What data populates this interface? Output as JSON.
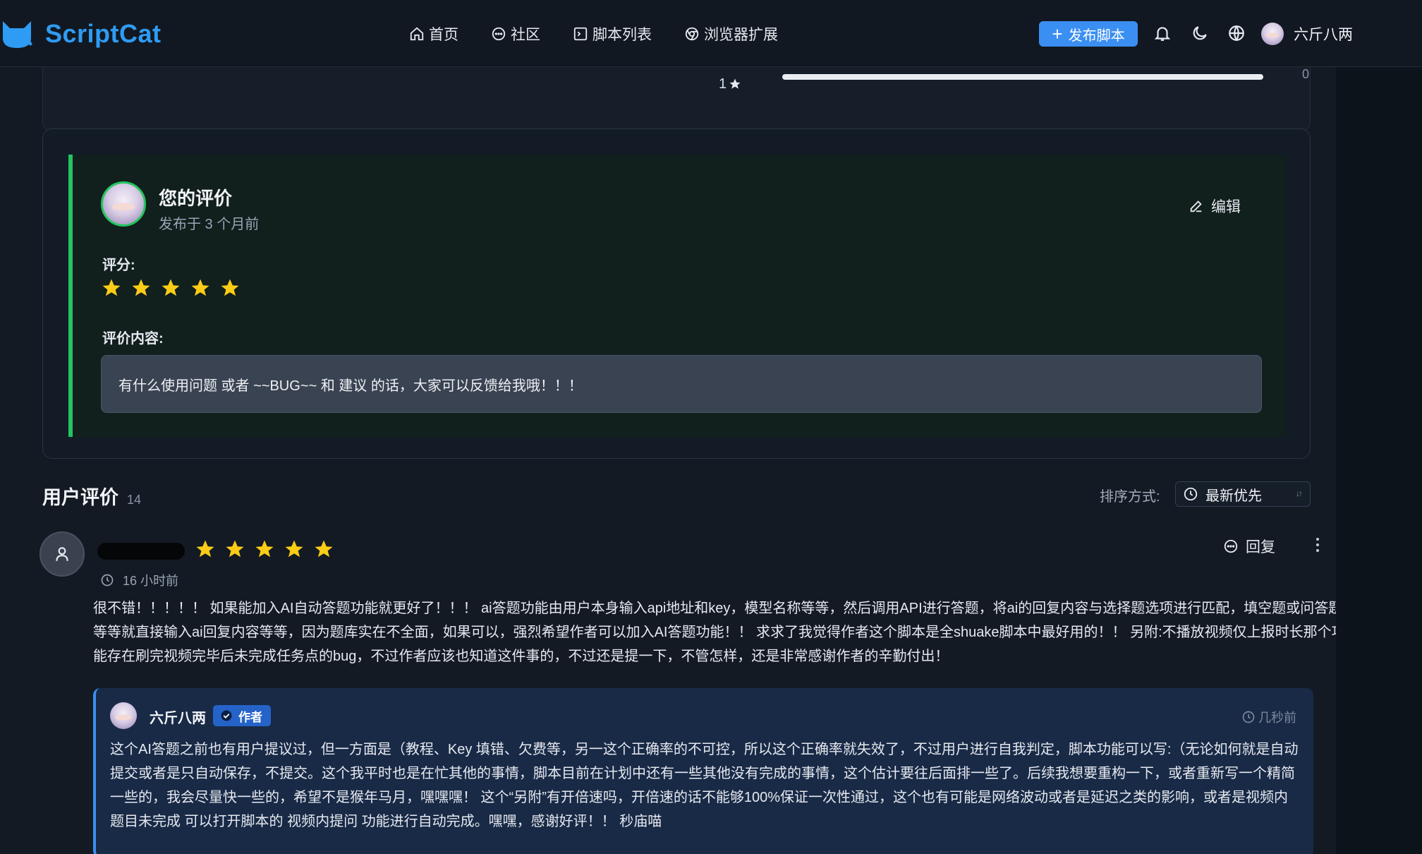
{
  "nav": {
    "brand": "ScriptCat",
    "links": [
      {
        "label": "首页",
        "icon": "home-icon"
      },
      {
        "label": "社区",
        "icon": "chat-icon"
      },
      {
        "label": "脚本列表",
        "icon": "terminal-icon"
      },
      {
        "label": "浏览器扩展",
        "icon": "chrome-icon"
      }
    ],
    "publish_label": "发布脚本",
    "user_name": "六斤八两",
    "accent": "#3b8ff3"
  },
  "rating_summary": {
    "row_label": "1",
    "row_count": "0"
  },
  "your_review": {
    "title": "您的评价",
    "time": "发布于 3 个月前",
    "edit_label": "编辑",
    "score_label": "评分:",
    "stars": 5,
    "content_label": "评价内容:",
    "content": "有什么使用问题 或者 ~~BUG~~ 和 建议 的话，大家可以反馈给我哦！！！",
    "accent": "#22c55e"
  },
  "user_reviews": {
    "title": "用户评价",
    "count": "14",
    "sort_label": "排序方式:",
    "sort_value": "最新优先",
    "items": [
      {
        "stars": 5,
        "time": "16 小时前",
        "reply_label": "回复",
        "body": "很不错！！！！！ 如果能加入AI自动答题功能就更好了！！！ ai答题功能由用户本身输入api地址和key，模型名称等等，然后调用API进行答题，将ai的回复内容与选择题选项进行匹配，填空题或问答题等等就直接输入ai回复内容等等，因为题库实在不全面，如果可以，强烈希望作者可以加入AI答题功能！！ 求求了我觉得作者这个脚本是全shuake脚本中最好用的！！ 另附:不播放视频仅上报时长那个功能存在刷完视频完毕后未完成任务点的bug，不过作者应该也知道这件事的，不过还是提一下，不管怎样，还是非常感谢作者的辛勤付出！",
        "reply": {
          "name": "六斤八两",
          "badge": "作者",
          "time": "几秒前",
          "body": "这个AI答题之前也有用户提议过，但一方面是（教程、Key 填错、欠费等，另一这个正确率的不可控，所以这个正确率就失效了，不过用户进行自我判定，脚本功能可以写:（无论如何就是自动提交或者是只自动保存，不提交。这个我平时也是在忙其他的事情，脚本目前在计划中还有一些其他没有完成的事情，这个估计要往后面排一些了。后续我想要重构一下，或者重新写一个精简一些的，我会尽量快一些的，希望不是猴年马月，嘿嘿嘿！ 这个“另附”有开倍速吗，开倍速的话不能够100%保证一次性通过，这个也有可能是网络波动或者是延迟之类的影响，或者是视频内题目未完成 可以打开脚本的 视频内提问 功能进行自动完成。嘿嘿，感谢好评！！ 秒庙喵"
        }
      }
    ]
  },
  "colors": {
    "star": "#facc15",
    "background": "#131a24"
  }
}
